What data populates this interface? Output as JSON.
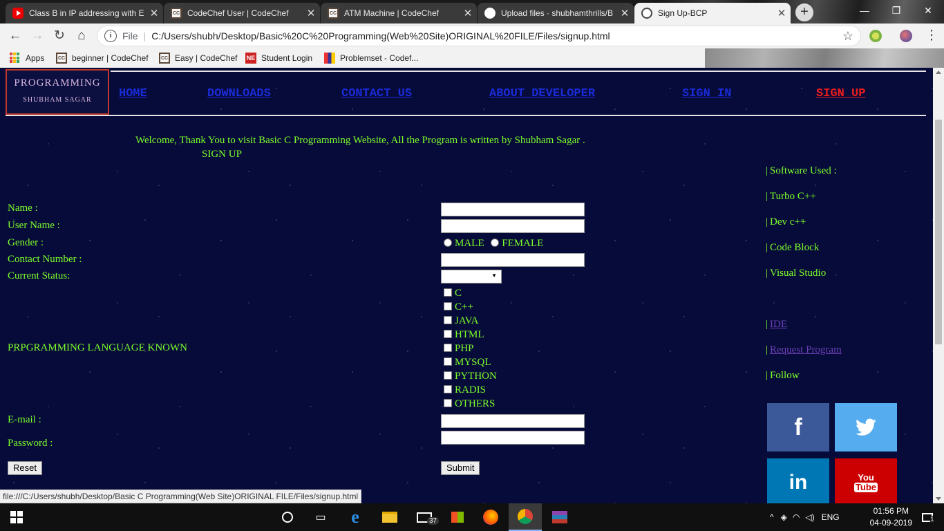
{
  "browser": {
    "tabs": [
      {
        "title": "Class B in IP addressing with E",
        "icon": "youtube-icon"
      },
      {
        "title": "CodeChef User | CodeChef",
        "icon": "codechef-icon"
      },
      {
        "title": "ATM Machine | CodeChef",
        "icon": "codechef-icon"
      },
      {
        "title": "Upload files · shubhamthrills/B",
        "icon": "github-icon"
      },
      {
        "title": "Sign Up-BCP",
        "icon": "globe-icon",
        "active": true
      }
    ],
    "address": {
      "scheme": "File",
      "url": "C:/Users/shubh/Desktop/Basic%20C%20Programming(Web%20Site)ORIGINAL%20FILE/Files/signup.html"
    },
    "bookmarks": [
      {
        "label": "Apps"
      },
      {
        "label": "beginner | CodeChef"
      },
      {
        "label": "Easy | CodeChef"
      },
      {
        "label": "Student Login"
      },
      {
        "label": "Problemset - Codef..."
      }
    ],
    "status_url": "file:///C:/Users/shubh/Desktop/Basic C Programming(Web Site)ORIGINAL FILE/Files/signup.html"
  },
  "site": {
    "logo": {
      "line1": "PROGRAMMING",
      "line2": "SHUBHAM SAGAR"
    },
    "nav": [
      {
        "label": "HOME"
      },
      {
        "label": "DOWNLOADS"
      },
      {
        "label": "CONTACT US"
      },
      {
        "label": "ABOUT DEVELOPER"
      },
      {
        "label": "SIGN IN"
      },
      {
        "label": "SIGN UP",
        "active": true
      }
    ],
    "welcome": "Welcome, Thank You to visit Basic C Programming Website, All the Program is written by Shubham Sagar .",
    "page_heading": "SIGN UP"
  },
  "form": {
    "name_label": "Name :",
    "username_label": "User Name :",
    "gender_label": "Gender :",
    "gender_options": [
      "MALE",
      "FEMALE"
    ],
    "contact_label": "Contact Number :",
    "status_label": "Current Status:",
    "languages_label": "PRPGRAMMING LANGUAGE KNOWN",
    "languages": [
      "C",
      "C++",
      "JAVA",
      "HTML",
      "PHP",
      "MYSQL",
      "PYTHON",
      "RADIS",
      "OTHERS"
    ],
    "email_label": "E-mail :",
    "password_label": "Password :",
    "reset_label": "Reset",
    "submit_label": "Submit"
  },
  "sidebar": {
    "software_heading": "Software Used :",
    "software": [
      "Turbo C++",
      "Dev c++",
      "Code Block",
      "Visual Studio"
    ],
    "links": [
      "IDE",
      "Request Program"
    ],
    "follow": "Follow"
  },
  "taskbar": {
    "language": "ENG",
    "time": "01:56 PM",
    "date": "04-09-2019",
    "mail_badge": "37",
    "notification_badge": "1"
  }
}
